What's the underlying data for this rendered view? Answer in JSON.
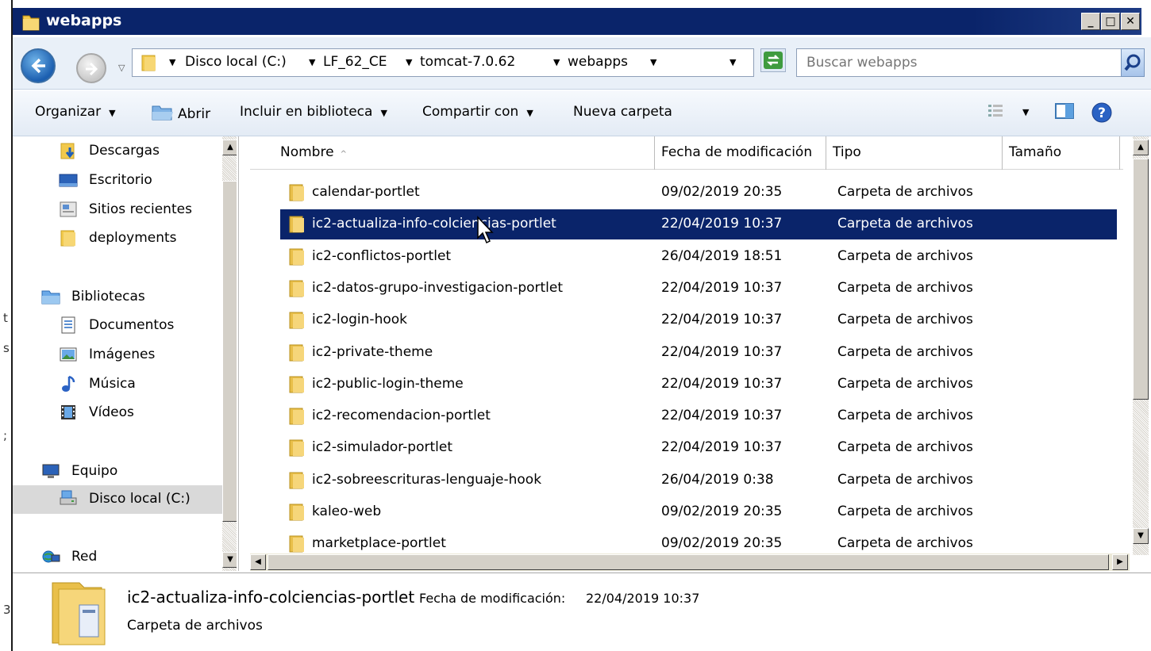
{
  "window": {
    "title": "webapps"
  },
  "addressbar": {
    "crumbs": [
      "Disco local (C:)",
      "LF_62_CE",
      "tomcat-7.0.62",
      "webapps"
    ],
    "search_placeholder": "Buscar webapps"
  },
  "toolbar": {
    "organize": "Organizar",
    "open": "Abrir",
    "include": "Incluir en biblioteca",
    "share": "Compartir con",
    "new_folder": "Nueva carpeta"
  },
  "nav": {
    "items": [
      {
        "label": "Descargas",
        "icon": "downloads-icon"
      },
      {
        "label": "Escritorio",
        "icon": "desktop-icon"
      },
      {
        "label": "Sitios recientes",
        "icon": "recent-places-icon"
      },
      {
        "label": "deployments",
        "icon": "folder-icon"
      },
      {
        "label": "Bibliotecas",
        "icon": "libraries-icon"
      },
      {
        "label": "Documentos",
        "icon": "documents-icon"
      },
      {
        "label": "Imágenes",
        "icon": "pictures-icon"
      },
      {
        "label": "Música",
        "icon": "music-icon"
      },
      {
        "label": "Vídeos",
        "icon": "videos-icon"
      },
      {
        "label": "Equipo",
        "icon": "computer-icon"
      },
      {
        "label": "Disco local (C:)",
        "icon": "local-disk-icon"
      },
      {
        "label": "Red",
        "icon": "network-icon"
      }
    ]
  },
  "columns": {
    "name": "Nombre",
    "date": "Fecha de modificación",
    "type": "Tipo",
    "size": "Tamaño"
  },
  "files": [
    {
      "name": "calendar-portlet",
      "date": "09/02/2019 20:35",
      "type": "Carpeta de archivos"
    },
    {
      "name": "ic2-actualiza-info-colciencias-portlet",
      "date": "22/04/2019 10:37",
      "type": "Carpeta de archivos",
      "selected": true
    },
    {
      "name": "ic2-conflictos-portlet",
      "date": "26/04/2019 18:51",
      "type": "Carpeta de archivos"
    },
    {
      "name": "ic2-datos-grupo-investigacion-portlet",
      "date": "22/04/2019 10:37",
      "type": "Carpeta de archivos"
    },
    {
      "name": "ic2-login-hook",
      "date": "22/04/2019 10:37",
      "type": "Carpeta de archivos"
    },
    {
      "name": "ic2-private-theme",
      "date": "22/04/2019 10:37",
      "type": "Carpeta de archivos"
    },
    {
      "name": "ic2-public-login-theme",
      "date": "22/04/2019 10:37",
      "type": "Carpeta de archivos"
    },
    {
      "name": "ic2-recomendacion-portlet",
      "date": "22/04/2019 10:37",
      "type": "Carpeta de archivos"
    },
    {
      "name": "ic2-simulador-portlet",
      "date": "22/04/2019 10:37",
      "type": "Carpeta de archivos"
    },
    {
      "name": "ic2-sobreescrituras-lenguaje-hook",
      "date": "26/04/2019 0:38",
      "type": "Carpeta de archivos"
    },
    {
      "name": "kaleo-web",
      "date": "09/02/2019 20:35",
      "type": "Carpeta de archivos"
    },
    {
      "name": "marketplace-portlet",
      "date": "09/02/2019 20:35",
      "type": "Carpeta de archivos"
    }
  ],
  "details": {
    "name": "ic2-actualiza-info-colciencias-portlet",
    "meta_label": "Fecha de modificación:",
    "meta_value": "22/04/2019 10:37",
    "type": "Carpeta de archivos"
  },
  "colors": {
    "titlebar": "#0a246a",
    "selection": "#0a246a",
    "folder": "#f2c94c"
  }
}
